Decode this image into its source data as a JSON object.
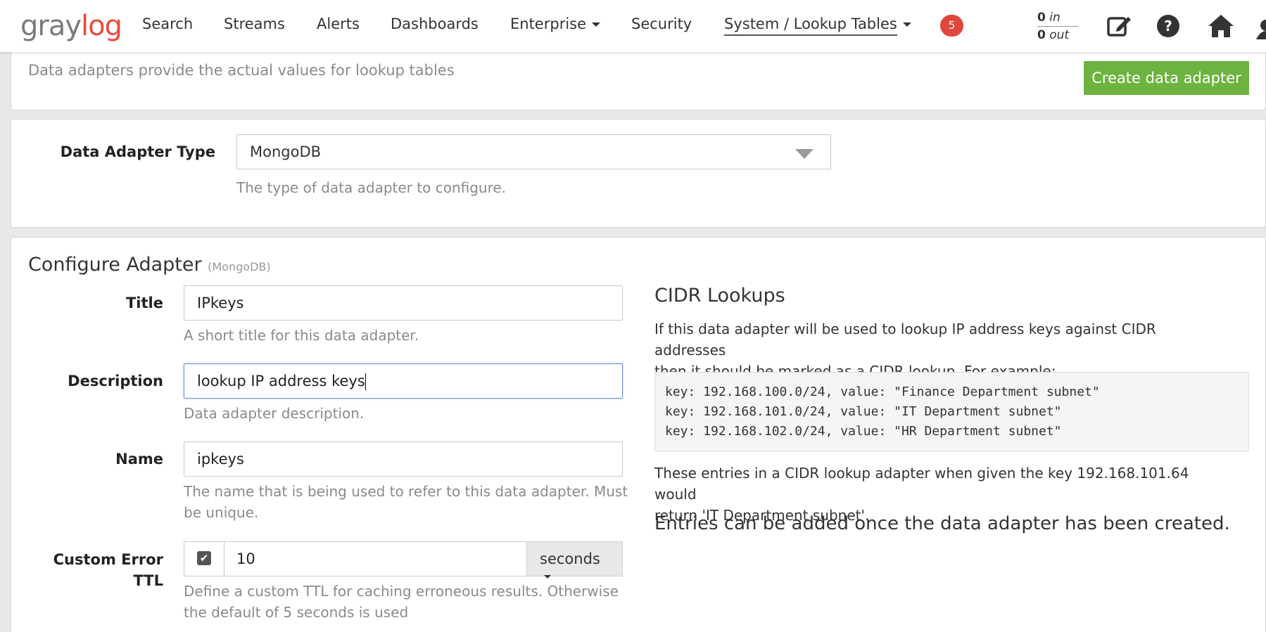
{
  "nav": {
    "logo_gray": "gray",
    "logo_red": "log",
    "items": [
      "Search",
      "Streams",
      "Alerts",
      "Dashboards",
      "Enterprise",
      "Security",
      "System / Lookup Tables"
    ],
    "notification_count": "5",
    "throughput": {
      "in_value": "0",
      "in_label": "in",
      "out_value": "0",
      "out_label": "out"
    },
    "icons": [
      "edit-icon",
      "help-icon",
      "home-icon"
    ]
  },
  "header": {
    "subtitle": "Data adapters provide the actual values for lookup tables",
    "create_button": "Create data adapter"
  },
  "adapter_type": {
    "label": "Data Adapter Type",
    "selected": "MongoDB",
    "help": "The type of data adapter to configure."
  },
  "configure": {
    "title": "Configure Adapter",
    "title_suffix": "(MongoDB)",
    "title_field": {
      "label": "Title",
      "value": "IPkeys",
      "help": "A short title for this data adapter."
    },
    "description_field": {
      "label": "Description",
      "value": "lookup IP address keys",
      "help": "Data adapter description."
    },
    "name_field": {
      "label": "Name",
      "value": "ipkeys",
      "help_line1": "The name that is being used to refer to this data adapter. Must",
      "help_line2": "be unique."
    },
    "ttl_field": {
      "label_line1": "Custom Error",
      "label_line2": "TTL",
      "checked": "✔",
      "value": "10",
      "unit": "seconds",
      "help_line1": "Define a custom TTL for caching erroneous results. Otherwise",
      "help_line2": "the default of 5 seconds is used"
    }
  },
  "cidr": {
    "title": "CIDR Lookups",
    "intro_line1": "If this data adapter will be used to lookup IP address keys against CIDR addresses",
    "intro_line2": "then it should be marked as a CIDR lookup. For example:",
    "code_lines": [
      "key: 192.168.100.0/24, value: \"Finance Department subnet\"",
      "key: 192.168.101.0/24, value: \"IT Department subnet\"",
      "key: 192.168.102.0/24, value: \"HR Department subnet\""
    ],
    "result_line1": "These entries in a CIDR lookup adapter when given the key 192.168.101.64 would",
    "result_line2": "return 'IT Department subnet'.",
    "note": "Entries can be added once the data adapter has been created."
  },
  "colors": {
    "accent_green": "#6db33f",
    "badge_red": "#e0463c",
    "logo_red": "#e74c3c"
  }
}
